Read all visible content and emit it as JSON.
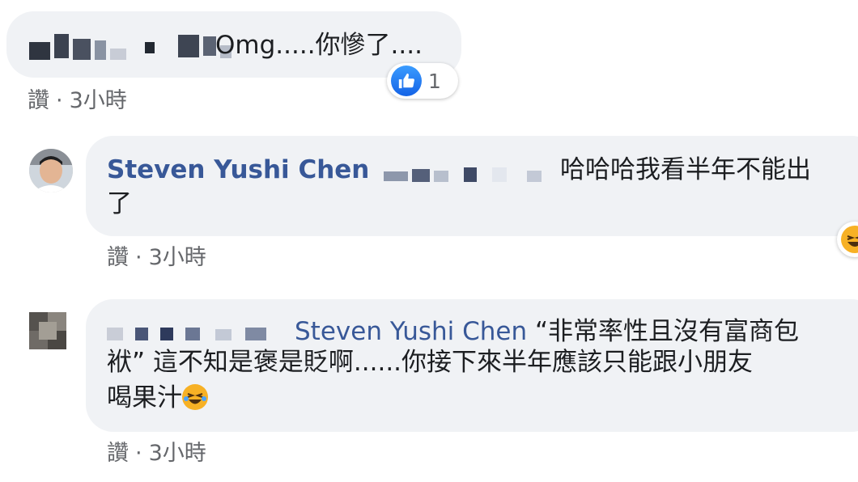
{
  "comments": [
    {
      "text": "Omg.....你慘了....",
      "reaction_count": "1",
      "action_like": "讚",
      "action_sep": "·",
      "action_time": "3小時",
      "colors": {
        "bubble": "#f0f2f5",
        "like": "#1877f2"
      },
      "icons": [
        "like-icon"
      ]
    },
    {
      "author": "Steven Yushi Chen",
      "line1": "哈哈哈我看半年不能出",
      "line2": "了",
      "action_like": "讚",
      "action_sep": "·",
      "action_time": "3小時",
      "icons": [
        "haha-icon"
      ]
    },
    {
      "mention": "Steven Yushi Chen",
      "line1_rest": "“非常率性且沒有富商包",
      "line2": "袱” 這不知是褒是貶啊......你接下來半年應該只能跟小朋友",
      "line3": "喝果汁",
      "action_like": "讚",
      "action_sep": "·",
      "action_time": "3小時",
      "icons": [
        "laughing-emoji-icon"
      ]
    }
  ]
}
